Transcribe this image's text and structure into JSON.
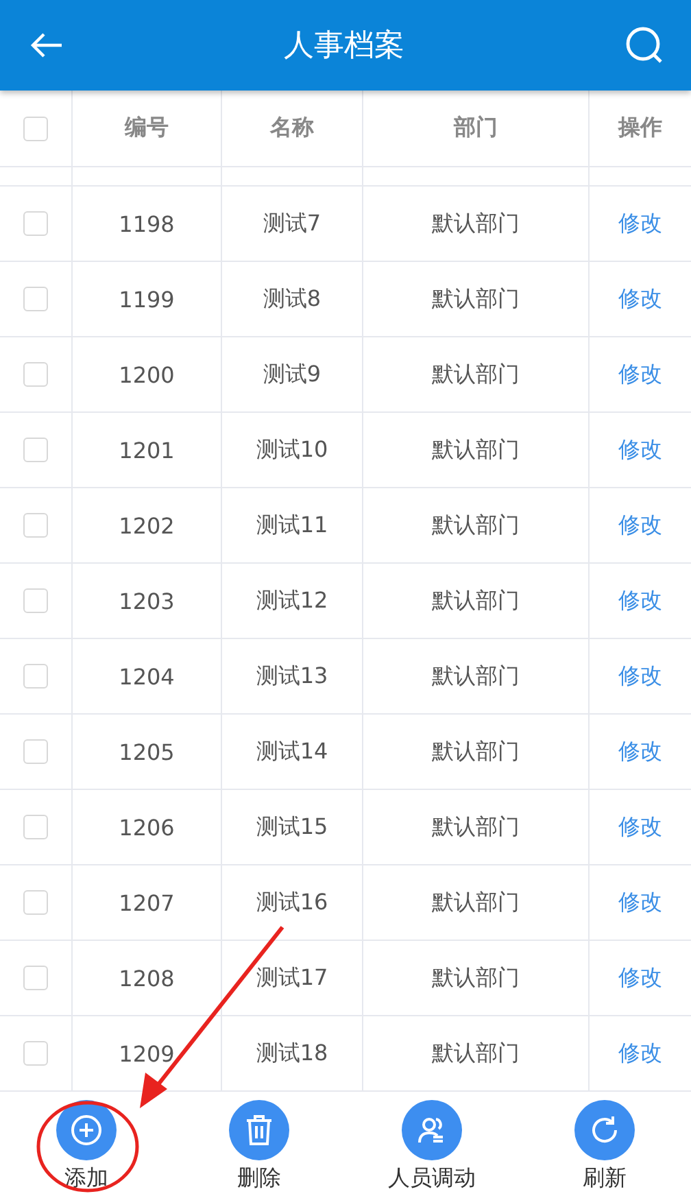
{
  "header": {
    "title": "人事档案"
  },
  "table": {
    "select_all_checked": false,
    "columns": [
      "编号",
      "名称",
      "部门",
      "操作"
    ],
    "rows": [
      {
        "checked": false,
        "id": "1198",
        "name": "测试7",
        "dept": "默认部门",
        "action": "修改"
      },
      {
        "checked": false,
        "id": "1199",
        "name": "测试8",
        "dept": "默认部门",
        "action": "修改"
      },
      {
        "checked": false,
        "id": "1200",
        "name": "测试9",
        "dept": "默认部门",
        "action": "修改"
      },
      {
        "checked": false,
        "id": "1201",
        "name": "测试10",
        "dept": "默认部门",
        "action": "修改"
      },
      {
        "checked": false,
        "id": "1202",
        "name": "测试11",
        "dept": "默认部门",
        "action": "修改"
      },
      {
        "checked": false,
        "id": "1203",
        "name": "测试12",
        "dept": "默认部门",
        "action": "修改"
      },
      {
        "checked": false,
        "id": "1204",
        "name": "测试13",
        "dept": "默认部门",
        "action": "修改"
      },
      {
        "checked": false,
        "id": "1205",
        "name": "测试14",
        "dept": "默认部门",
        "action": "修改"
      },
      {
        "checked": false,
        "id": "1206",
        "name": "测试15",
        "dept": "默认部门",
        "action": "修改"
      },
      {
        "checked": false,
        "id": "1207",
        "name": "测试16",
        "dept": "默认部门",
        "action": "修改"
      },
      {
        "checked": false,
        "id": "1208",
        "name": "测试17",
        "dept": "默认部门",
        "action": "修改"
      },
      {
        "checked": false,
        "id": "1209",
        "name": "测试18",
        "dept": "默认部门",
        "action": "修改"
      }
    ]
  },
  "toolbar": [
    {
      "kind": "add",
      "label": "添加"
    },
    {
      "kind": "delete",
      "label": "删除"
    },
    {
      "kind": "transfer",
      "label": "人员调动"
    },
    {
      "kind": "refresh",
      "label": "刷新"
    }
  ]
}
